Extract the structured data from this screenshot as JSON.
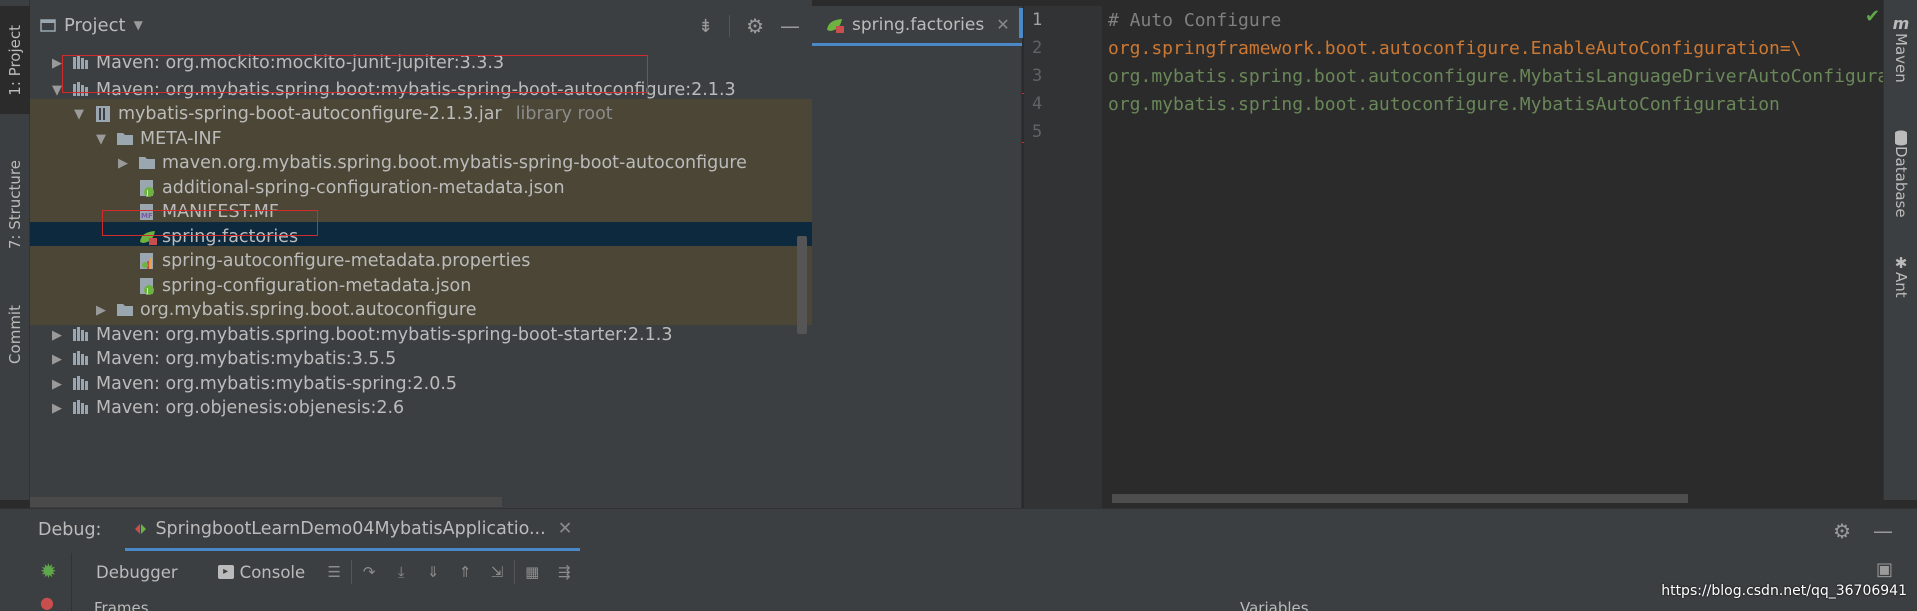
{
  "left_strip": {
    "project": "1: Project",
    "structure": "7: Structure",
    "commit": "Commit"
  },
  "right_strip": {
    "maven": "Maven",
    "database": "Database",
    "ant": "Ant"
  },
  "project_panel": {
    "title": "Project"
  },
  "tree": [
    {
      "indent": 0,
      "arrow": "right",
      "icon": "maven-lib-icon",
      "label": "Maven: org.mockito:mockito-junit-jupiter:3.3.3",
      "extra": ""
    },
    {
      "indent": 0,
      "arrow": "down",
      "icon": "maven-lib-icon",
      "label": "Maven: org.mybatis.spring.boot:mybatis-spring-boot-autoconfigure:2.1.3",
      "extra": ""
    },
    {
      "indent": 1,
      "arrow": "down",
      "icon": "jar-icon",
      "label": "mybatis-spring-boot-autoconfigure-2.1.3.jar",
      "extra": "library root"
    },
    {
      "indent": 2,
      "arrow": "down",
      "icon": "folder-icon",
      "label": "META-INF",
      "extra": ""
    },
    {
      "indent": 3,
      "arrow": "right",
      "icon": "folder-icon",
      "label": "maven.org.mybatis.spring.boot.mybatis-spring-boot-autoconfigure",
      "extra": ""
    },
    {
      "indent": 3,
      "arrow": "none",
      "icon": "json-icon",
      "label": "additional-spring-configuration-metadata.json",
      "extra": ""
    },
    {
      "indent": 3,
      "arrow": "none",
      "icon": "manifest-icon",
      "label": "MANIFEST.MF",
      "extra": ""
    },
    {
      "indent": 3,
      "arrow": "none",
      "icon": "spring-factories-icon",
      "label": "spring.factories",
      "extra": ""
    },
    {
      "indent": 3,
      "arrow": "none",
      "icon": "properties-icon",
      "label": "spring-autoconfigure-metadata.properties",
      "extra": ""
    },
    {
      "indent": 3,
      "arrow": "none",
      "icon": "json-icon",
      "label": "spring-configuration-metadata.json",
      "extra": ""
    },
    {
      "indent": 2,
      "arrow": "right",
      "icon": "folder-icon",
      "label": "org.mybatis.spring.boot.autoconfigure",
      "extra": ""
    },
    {
      "indent": 0,
      "arrow": "right",
      "icon": "maven-lib-icon",
      "label": "Maven: org.mybatis.spring.boot:mybatis-spring-boot-starter:2.1.3",
      "extra": ""
    },
    {
      "indent": 0,
      "arrow": "right",
      "icon": "maven-lib-icon",
      "label": "Maven: org.mybatis:mybatis:3.5.5",
      "extra": ""
    },
    {
      "indent": 0,
      "arrow": "right",
      "icon": "maven-lib-icon",
      "label": "Maven: org.mybatis:mybatis-spring:2.0.5",
      "extra": ""
    },
    {
      "indent": 0,
      "arrow": "right",
      "icon": "maven-lib-icon",
      "label": "Maven: org.objenesis:objenesis:2.6",
      "extra": ""
    }
  ],
  "editor": {
    "tab_name": "spring.factories",
    "lines": [
      {
        "num": "1",
        "text": "# Auto Configure",
        "kind": "comment"
      },
      {
        "num": "2",
        "text": "org.springframework.boot.autoconfigure.EnableAutoConfiguration=\\",
        "kind": "key"
      },
      {
        "num": "3",
        "text": "org.mybatis.spring.boot.autoconfigure.MybatisLanguageDriverAutoConfiguration,\\",
        "kind": "val"
      },
      {
        "num": "4",
        "text": "org.mybatis.spring.boot.autoconfigure.MybatisAutoConfiguration",
        "kind": "val"
      },
      {
        "num": "5",
        "text": "",
        "kind": "val"
      }
    ]
  },
  "debug": {
    "label": "Debug:",
    "run_config": "SpringbootLearnDemo04MybatisApplicatio...",
    "debugger_tab": "Debugger",
    "console_tab": "Console",
    "frames": "Frames",
    "variables": "Variables",
    "watermark": "https://blog.csdn.net/qq_36706941"
  },
  "colors": {
    "highlight_red": "#d22b2b",
    "selection": "#0d293e",
    "library_root_bg": "#4b4636",
    "string_green": "#6a8759",
    "keyword_orange": "#cc7832"
  }
}
